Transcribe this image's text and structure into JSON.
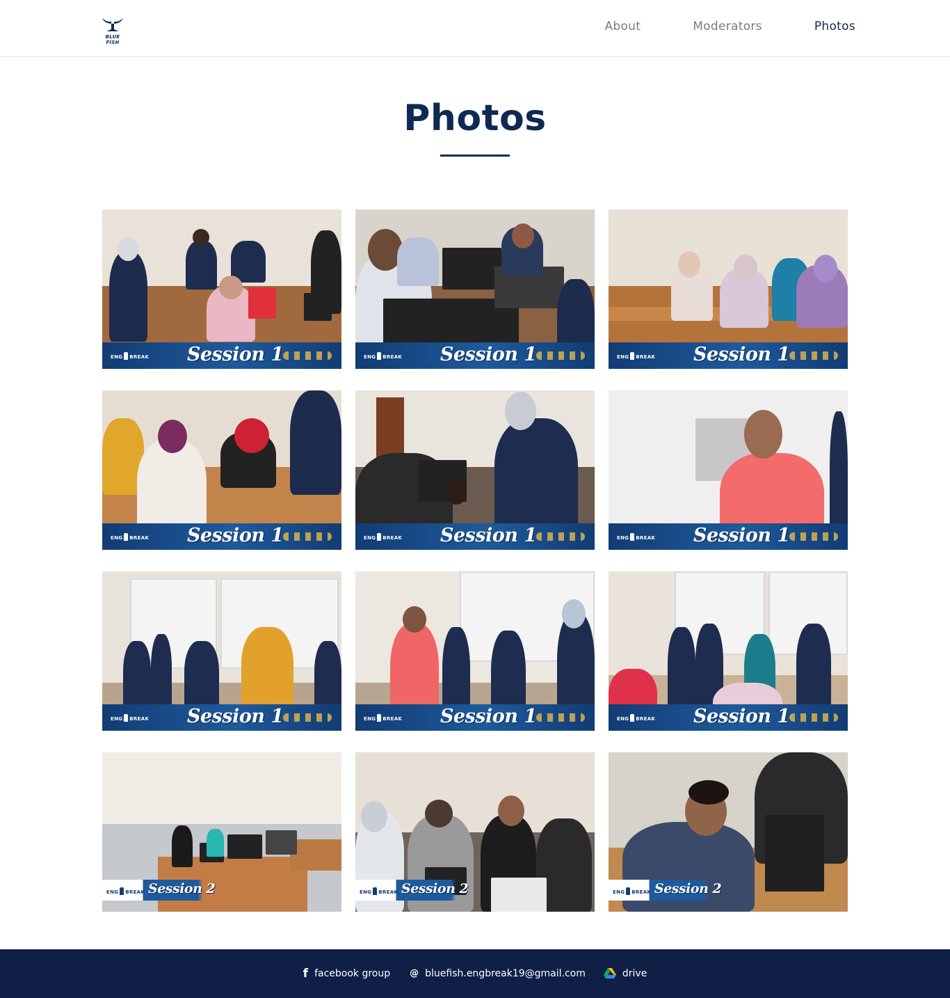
{
  "header": {
    "logo_text": "BLUE FISH",
    "nav": [
      {
        "label": "About",
        "active": false
      },
      {
        "label": "Moderators",
        "active": false
      },
      {
        "label": "Photos",
        "active": true
      }
    ]
  },
  "main": {
    "title": "Photos",
    "photos": [
      {
        "session": "Session 1",
        "logo": "ENG BREAK"
      },
      {
        "session": "Session 1",
        "logo": "ENG BREAK"
      },
      {
        "session": "Session 1",
        "logo": "ENG BREAK"
      },
      {
        "session": "Session 1",
        "logo": "ENG BREAK"
      },
      {
        "session": "Session 1",
        "logo": "ENG BREAK"
      },
      {
        "session": "Session 1",
        "logo": "ENG BREAK"
      },
      {
        "session": "Session 1",
        "logo": "ENG BREAK"
      },
      {
        "session": "Session 1",
        "logo": "ENG BREAK"
      },
      {
        "session": "Session 1",
        "logo": "ENG BREAK"
      },
      {
        "session": "Session 2",
        "logo": "ENG BREAK"
      },
      {
        "session": "Session 2",
        "logo": "ENG BREAK"
      },
      {
        "session": "Session 2",
        "logo": "ENG BREAK"
      }
    ]
  },
  "footer": {
    "facebook_label": "facebook group",
    "facebook_icon": "facebook-icon",
    "email_label": "bluefish.engbreak19@gmail.com",
    "email_icon": "at-icon",
    "drive_label": "drive",
    "drive_icon": "google-drive-icon"
  },
  "colors": {
    "brand_navy": "#0f2a52",
    "footer_bg": "#0f1f46",
    "nav_inactive": "#7a7a7a",
    "banner_blue": "#1e5a9c"
  }
}
